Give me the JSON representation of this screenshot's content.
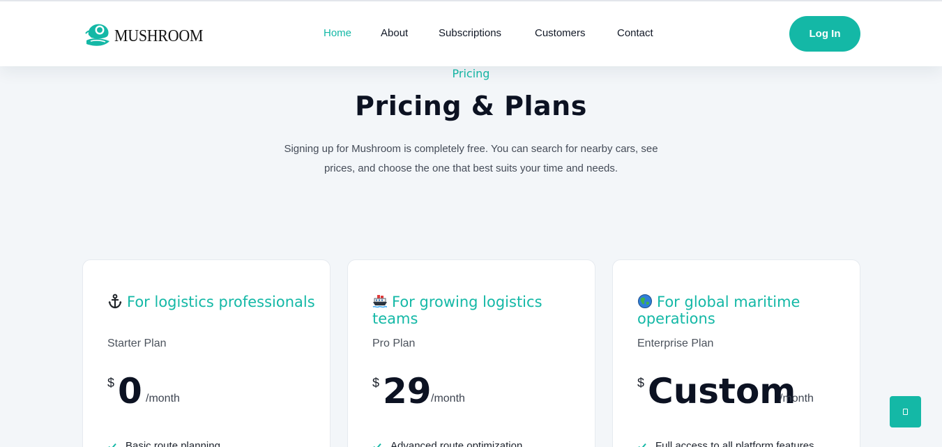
{
  "brand": {
    "name": "MUSHROOM"
  },
  "nav": {
    "items": [
      {
        "label": "Home",
        "active": true
      },
      {
        "label": "About",
        "active": false
      },
      {
        "label": "Subscriptions",
        "active": false
      },
      {
        "label": "Customers",
        "active": false
      },
      {
        "label": "Contact",
        "active": false
      }
    ],
    "login_label": "Log In"
  },
  "hero": {
    "eyebrow": "Pricing",
    "title": "Pricing & Plans",
    "description": "Signing up for Mushroom is completely free. You can search for nearby cars, see prices, and choose the one that best suits your time and needs."
  },
  "plans": [
    {
      "icon": "anchor-icon",
      "heading": "For logistics professionals",
      "name": "Starter Plan",
      "currency": "$",
      "price": "0",
      "period": "/month",
      "first_feature": "Basic route planning"
    },
    {
      "icon": "ship-icon",
      "heading": "For growing logistics teams",
      "name": "Pro Plan",
      "currency": "$",
      "price": "29",
      "period": "/month",
      "first_feature": "Advanced route optimization"
    },
    {
      "icon": "globe-icon",
      "heading": "For global maritime operations",
      "name": "Enterprise Plan",
      "currency": "$",
      "price": "Custom",
      "period": "/month",
      "first_feature": "Full access to all platform features"
    }
  ],
  "colors": {
    "accent": "#14b8a6",
    "background": "#f3f6f9",
    "heading": "#0c1222"
  },
  "scroll_top": {
    "icon": "scroll-to-top-icon"
  }
}
